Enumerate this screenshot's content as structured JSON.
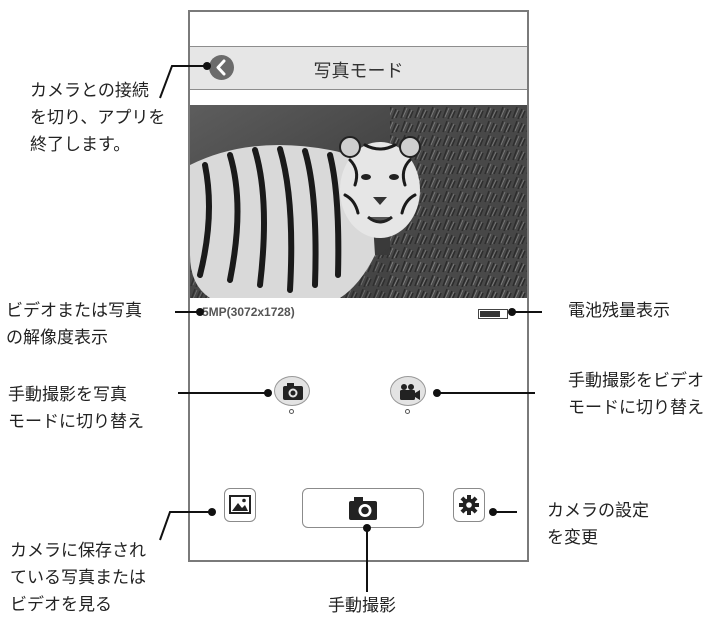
{
  "app": {
    "title": "写真モード",
    "resolution_text": "5MP(3072x1728)",
    "battery_level": 0.75
  },
  "annotations": {
    "back_desc": [
      "カメラとの接続",
      "を切り、アプリを",
      "終了します。"
    ],
    "resolution_desc": [
      "ビデオまたは写真",
      "の解像度表示"
    ],
    "battery_desc": "電池残量表示",
    "photo_mode_desc": [
      "手動撮影を写真",
      "モードに切り替え"
    ],
    "video_mode_desc": [
      "手動撮影をビデオ",
      "モードに切り替え"
    ],
    "gallery_desc": [
      "カメラに保存され",
      "ている写真または",
      "ビデオを見る"
    ],
    "settings_desc": [
      "カメラの設定",
      "を変更"
    ],
    "shutter_desc": "手動撮影"
  },
  "icons": {
    "back": "chevron-left-icon",
    "photo_mode": "camera-icon",
    "video_mode": "video-camera-icon",
    "gallery": "image-icon",
    "shutter": "camera-icon",
    "settings": "gear-icon"
  }
}
